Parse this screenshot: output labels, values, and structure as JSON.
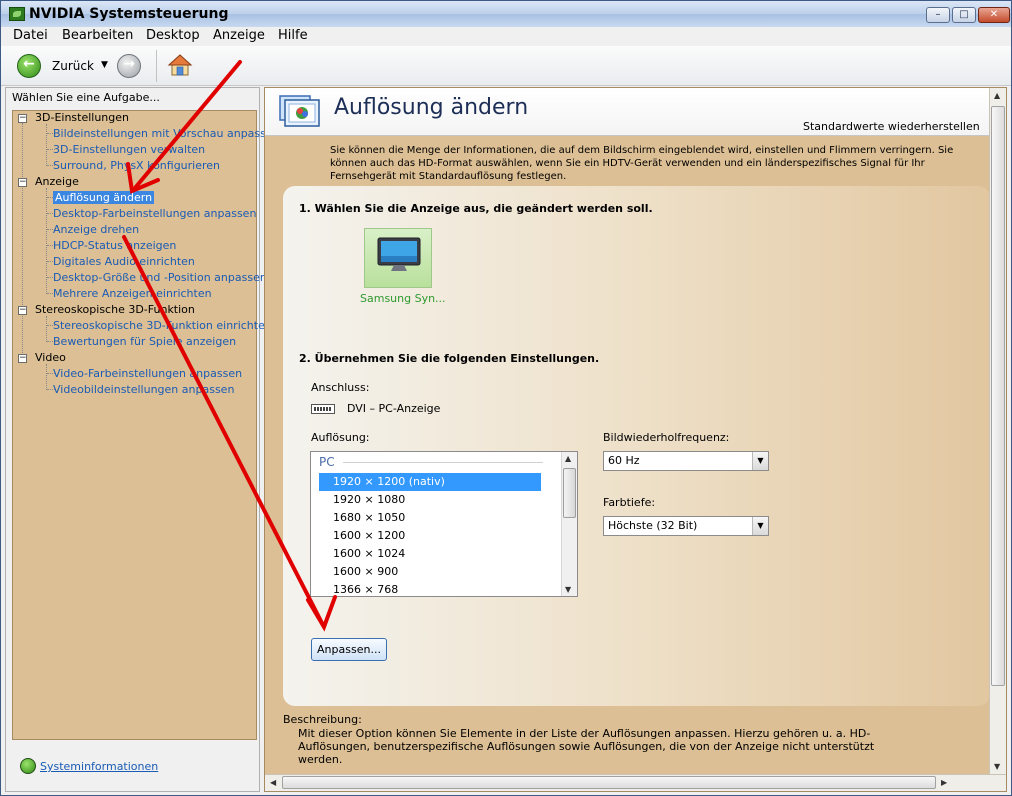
{
  "window": {
    "title": "NVIDIA Systemsteuerung",
    "controls": {
      "minimize": "–",
      "maximize": "□",
      "close": "✕"
    }
  },
  "menu": [
    "Datei",
    "Bearbeiten",
    "Desktop",
    "Anzeige",
    "Hilfe"
  ],
  "toolbar": {
    "back_label": "Zurück",
    "back_icon": "back-arrow-icon",
    "forward_icon": "forward-arrow-icon",
    "home_icon": "home-icon"
  },
  "sidebar": {
    "header": "Wählen Sie eine Aufgabe...",
    "categories": [
      {
        "label": "3D-Einstellungen",
        "items": [
          "Bildeinstellungen mit Vorschau anpassen",
          "3D-Einstellungen verwalten",
          "Surround, PhysX konfigurieren"
        ]
      },
      {
        "label": "Anzeige",
        "items": [
          "Auflösung ändern",
          "Desktop-Farbeinstellungen anpassen",
          "Anzeige drehen",
          "HDCP-Status anzeigen",
          "Digitales Audio einrichten",
          "Desktop-Größe und -Position anpassen",
          "Mehrere Anzeigen einrichten"
        ]
      },
      {
        "label": "Stereoskopische 3D-Funktion",
        "items": [
          "Stereoskopische 3D-Funktion einrichten",
          "Bewertungen für Spiele anzeigen"
        ]
      },
      {
        "label": "Video",
        "items": [
          "Video-Farbeinstellungen anpassen",
          "Videobildeinstellungen anpassen"
        ]
      }
    ],
    "selected_item": "Auflösung ändern",
    "system_info": "Systeminformationen"
  },
  "main": {
    "title": "Auflösung ändern",
    "restore_defaults": "Standardwerte wiederherstellen",
    "intro": "Sie können die Menge der Informationen, die auf dem Bildschirm eingeblendet wird, einstellen und Flimmern verringern. Sie können auch das HD-Format auswählen, wenn Sie ein HDTV-Gerät verwenden und ein länderspezifisches Signal für Ihr Fernsehgerät mit Standardauflösung festlegen.",
    "step1": "1. Wählen Sie die Anzeige aus, die geändert werden soll.",
    "display_name": "Samsung Syn...",
    "step2": "2. Übernehmen Sie die folgenden Einstellungen.",
    "connection_label": "Anschluss:",
    "connection_value": "DVI – PC-Anzeige",
    "resolution_label": "Auflösung:",
    "resolution_group": "PC",
    "resolutions": [
      "1920 × 1200 (nativ)",
      "1920 × 1080",
      "1680 × 1050",
      "1600 × 1200",
      "1600 × 1024",
      "1600 × 900",
      "1366 × 768"
    ],
    "selected_resolution": "1920 × 1200 (nativ)",
    "refresh_label": "Bildwiederholfrequenz:",
    "refresh_value": "60 Hz",
    "color_depth_label": "Farbtiefe:",
    "color_depth_value": "Höchste (32 Bit)",
    "customize_button": "Anpassen...",
    "description_label": "Beschreibung:",
    "description_text": "Mit dieser Option können Sie Elemente in der Liste der Auflösungen anpassen. Hierzu gehören u. a. HD-Auflösungen, benutzerspezifische Auflösungen sowie Auflösungen, die von der Anzeige nicht unterstützt werden."
  },
  "colors": {
    "panel_bg": "#dcbf94",
    "link": "#1a5bb5",
    "selection": "#3399ff",
    "annotation_arrow": "#e00000"
  }
}
